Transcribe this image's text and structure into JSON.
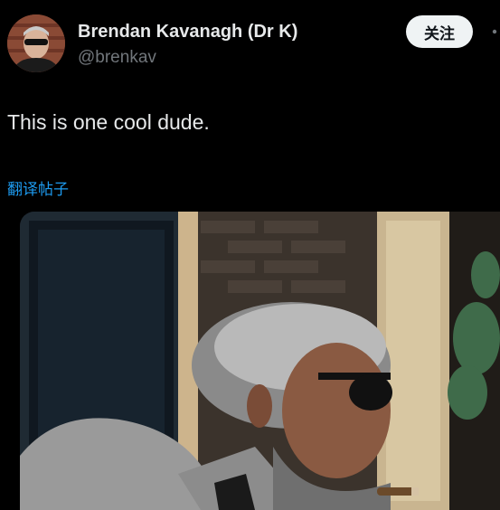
{
  "author": {
    "display_name": "Brendan Kavanagh (Dr K)",
    "handle": "@brenkav",
    "avatar_icon": "user-avatar-icon"
  },
  "actions": {
    "follow_label": "关注",
    "more_icon": "more-options-icon"
  },
  "tweet": {
    "text": "This is one cool dude.",
    "translate_label": "翻译帖子"
  },
  "media": {
    "description_icon": "photo-icon"
  },
  "colors": {
    "background": "#000000",
    "text_primary": "#e7e9ea",
    "text_secondary": "#71767b",
    "link": "#1d9bf0",
    "follow_button_bg": "#eff3f4"
  }
}
